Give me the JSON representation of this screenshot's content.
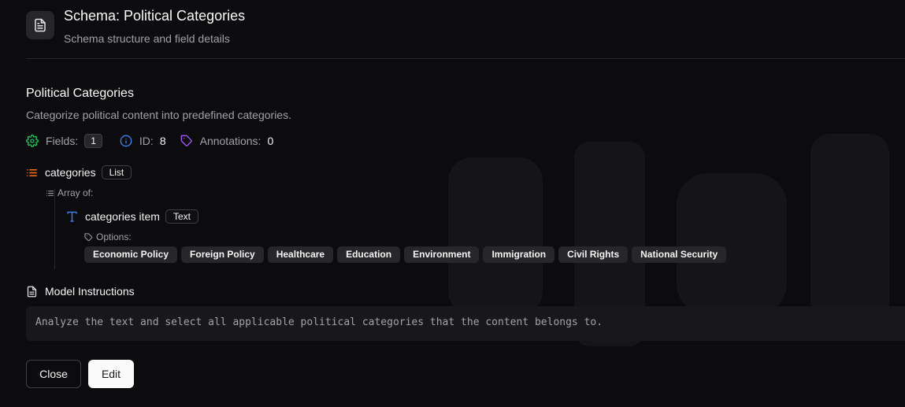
{
  "header": {
    "title": "Schema: Political Categories",
    "subtitle": "Schema structure and field details"
  },
  "schema": {
    "name": "Political Categories",
    "description": "Categorize political content into predefined categories.",
    "fields_label": "Fields:",
    "fields_count": "1",
    "id_label": "ID:",
    "id_value": "8",
    "annotations_label": "Annotations:",
    "annotations_value": "0"
  },
  "field": {
    "name": "categories",
    "type": "List",
    "array_of_label": "Array of:",
    "item": {
      "name": "categories item",
      "type": "Text",
      "options_label": "Options:",
      "options": [
        "Economic Policy",
        "Foreign Policy",
        "Healthcare",
        "Education",
        "Environment",
        "Immigration",
        "Civil Rights",
        "National Security"
      ]
    }
  },
  "instructions": {
    "label": "Model Instructions",
    "text": "Analyze the text and select all applicable political categories that the content belongs to."
  },
  "buttons": {
    "close": "Close",
    "edit": "Edit"
  },
  "colors": {
    "list_icon": "#f97316",
    "text_icon": "#3b82f6",
    "fields_icon": "#22c55e",
    "id_icon": "#3b82f6",
    "tag_icon": "#a855f7"
  }
}
